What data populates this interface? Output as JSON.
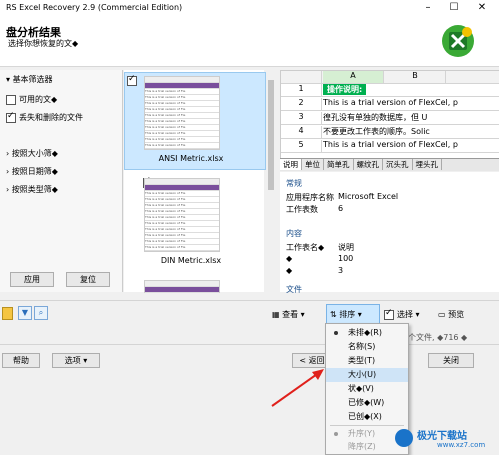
{
  "window": {
    "title": "RS Excel Recovery 2.9 (Commercial Edition)"
  },
  "header": {
    "title": "盘分析结果",
    "subtitle": "选择你想恢复的文◆"
  },
  "filters": {
    "basic_label": "基本筛选器",
    "available_files": "可用的文◆",
    "lost_deleted": "丢失和删除的文件",
    "by_size": "按照大小筛◆",
    "by_date": "按照日期筛◆",
    "by_type": "按照类型筛◆",
    "apply": "应用",
    "reset": "复位"
  },
  "files": [
    {
      "name": "ANSI Metric.xlsx",
      "checked": true,
      "selected": true
    },
    {
      "name": "DIN Metric.xlsx",
      "checked": true,
      "selected": false
    },
    {
      "name": "",
      "checked": false,
      "selected": false
    }
  ],
  "thumb_text": "This is a trial version of Fle",
  "preview": {
    "col_a": "A",
    "col_b": "B",
    "rows": [
      {
        "n": "1",
        "text": "操作说明:"
      },
      {
        "n": "2",
        "text": "This is a trial version of FlexCel, p"
      },
      {
        "n": "3",
        "text": "徨孔没有单独的数据库，但 U"
      },
      {
        "n": "4",
        "text": "不要更改工作表的顺序。Solic"
      },
      {
        "n": "5",
        "text": "This is a trial version of FlexCel, p"
      }
    ],
    "sheet_tabs": [
      "说明",
      "单位",
      "简单孔",
      "螺纹孔",
      "沉头孔",
      "埋头孔"
    ]
  },
  "properties": {
    "general": "常规",
    "app_name_label": "应用程序名称",
    "app_name_value": "Microsoft Excel",
    "sheet_count_label": "工作表数",
    "sheet_count_value": "6",
    "content": "内容",
    "sheet_name_label": "工作表名◆",
    "sheet_name_value": "说明",
    "row1_label": "◆",
    "row1_value": "100",
    "row2_label": "◆",
    "row2_value": "3",
    "file": "文件"
  },
  "toolbar": {
    "view": "查看",
    "sort": "排序",
    "select": "选择",
    "preview": "预览",
    "status": "个文件, ◆716 ◆"
  },
  "bottom": {
    "help": "帮助",
    "options": "选项",
    "back": "< 返回",
    "close": "关闭"
  },
  "sort_menu": [
    {
      "label": "未排◆(R)",
      "bullet": true,
      "disabled": false
    },
    {
      "label": "名称(S)",
      "bullet": false,
      "disabled": false
    },
    {
      "label": "类型(T)",
      "bullet": false,
      "disabled": false
    },
    {
      "label": "大小(U)",
      "bullet": false,
      "disabled": false,
      "selected": true
    },
    {
      "label": "状◆(V)",
      "bullet": false,
      "disabled": false
    },
    {
      "label": "已修◆(W)",
      "bullet": false,
      "disabled": false
    },
    {
      "label": "已创◆(X)",
      "bullet": false,
      "disabled": false
    },
    {
      "label": "升序(Y)",
      "bullet": true,
      "disabled": true
    },
    {
      "label": "降序(Z)",
      "bullet": false,
      "disabled": true
    }
  ],
  "watermark": {
    "text": "极光下载站",
    "url": "www.xz7.com"
  },
  "colors": {
    "accent": "#cce8ff",
    "green_header": "#00b050",
    "arrow": "#e0201b"
  }
}
